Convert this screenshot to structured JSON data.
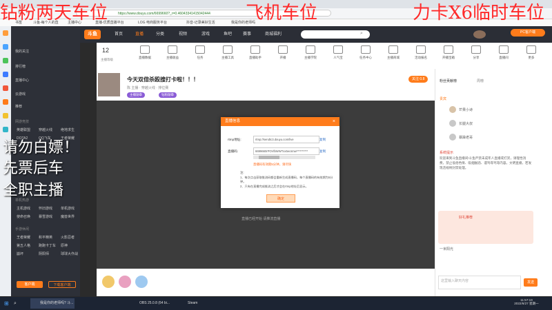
{
  "browser": {
    "url": "https://www.douyu.com/6699660?_r=0.46043341415042444",
    "bookmarks": [
      "书签",
      "斗鱼-每个人的直",
      "主播中心",
      "直播-优质直播平台",
      "LOG 电商服务平台",
      "抖音-记录美好生活",
      "我是你的老师吗"
    ]
  },
  "overlay": {
    "top_left": "钻粉两天车位",
    "top_mid": "飞机车位",
    "top_right": "力卡X6临时车位",
    "line1": "请勿白嫖！",
    "line2": "先票后车",
    "line3": "全职主播"
  },
  "leftnav": {
    "top": [
      "我的关注",
      "排行榜",
      "直播中心",
      "云游戏",
      "推荐"
    ],
    "sections": [
      {
        "title": "网游竞技",
        "items": [
          "英雄联盟",
          "穿越火线",
          "绝地求生",
          "DOTA2",
          "QQ飞车",
          "王者荣耀"
        ]
      },
      {
        "title": "单机热游",
        "items": [
          "主机游戏",
          "怀旧游戏",
          "单机游戏",
          "使命召唤",
          "暴雪游戏",
          "魔兽世界"
        ]
      },
      {
        "title": "手游休闲",
        "items": [
          "王者荣耀",
          "和平精英",
          "火影忍者",
          "第五人格",
          "跑跑卡丁车",
          "原神",
          "崩坏",
          "阴阳师",
          "球球大作战"
        ]
      }
    ],
    "open_button": "客户端",
    "download_button": "下载客户端"
  },
  "topnav": {
    "logo": "斗鱼",
    "items": [
      "首页",
      "直播",
      "分类",
      "视频",
      "游戏",
      "鱼吧",
      "赛事",
      "商城福利"
    ],
    "right_button": "PC客户端"
  },
  "toolbar": {
    "stat_number": "12",
    "stat_label": "主播等级",
    "items": [
      "直播数据",
      "主播收益",
      "任务",
      "主播工具",
      "直播助手",
      "开播",
      "主播学院",
      "人气宝",
      "任务中心",
      "主播商城",
      "活动报名",
      "开播宝箱",
      "分享",
      "直播间",
      "更多"
    ]
  },
  "room": {
    "title": "今天双倍杀殴搜打卡啦！！！",
    "meta": "陈 主播 · 穿越火线 · 排位赛",
    "badge1": "主播勋章",
    "badge2": "钻粉勋章",
    "follow_label": "关注",
    "follow_count": "0.8"
  },
  "modal": {
    "title": "直播信息",
    "rtmp_label": "rtmp地址:",
    "rtmp_value": "rtmp://sendtc3.douyu.com/live",
    "code_label": "直播码:",
    "code_value": "6699660rPOVlbWWTxx5ecsmw**********",
    "copy_label": "复制",
    "warning": "直播码有效期5分钟，请尽快",
    "note_title": "注:",
    "note1": "1、每次点击获取推流码都会重新生成直播码，每个直播码的有效期为5分钟。",
    "note2": "2、只有在直播完成推流之后才会在rtmp地址后显示。",
    "confirm": "确定"
  },
  "video": {
    "status": "直播已经开始  请推流直播"
  },
  "right": {
    "tabs": [
      "粉丝贡献榜",
      "周榜"
    ],
    "rank_header": "贵宾",
    "users": [
      "芒果小诗",
      "长腿大叔",
      "暴躁老哥",
      "一米阳光"
    ],
    "notice_title": "系统提示",
    "notice": "欢迎来到斗鱼直播间!斗鱼严禁未成年人直播或打赏，请理性消费，禁止低俗色情、吸烟酗酒、谩骂辱骂等内容。文明直播，若发现违规将封禁处理。",
    "gift_title": "好礼推荐",
    "chat_placeholder": "这里输入聊天内容",
    "send": "发送"
  },
  "taskbar": {
    "apps": [
      "我是你的老师吗? 斗...",
      "OBS 25.0.8 (64 bi...",
      "Steam"
    ],
    "time": "11:57:19",
    "date": "2022/6/27 星期一"
  },
  "colors": {
    "accent": "#ff7c1b",
    "nav_bg": "#2d3038",
    "overlay_red": "#ff2a2a"
  }
}
